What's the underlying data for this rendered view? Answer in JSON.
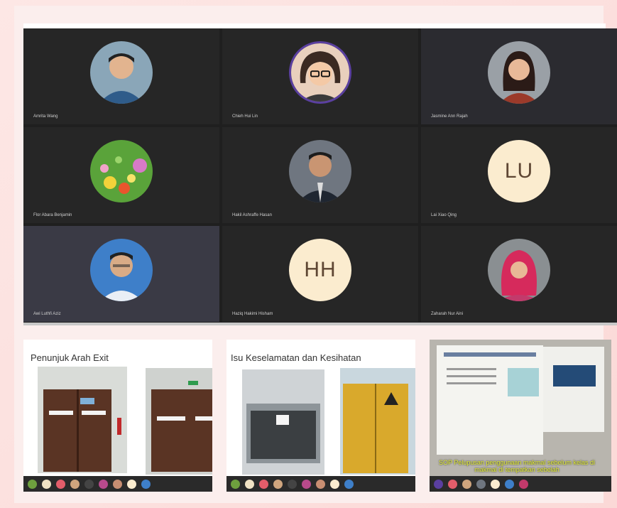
{
  "meeting": {
    "participants": [
      {
        "name": "Amrita Wang",
        "type": "photo",
        "tone": "#8aa6b8"
      },
      {
        "name": "Chieh Hui Lin",
        "type": "avatar",
        "tone": "#5a3fa0"
      },
      {
        "name": "Jasmine Ann Rajah",
        "type": "photo",
        "tone": "#9b6a5a"
      },
      {
        "name": "Flor Abara Benjamin",
        "type": "flowers",
        "tone": "#5aa33a"
      },
      {
        "name": "Hakil Ashraffe Hasan",
        "type": "photo",
        "tone": "#6f7680"
      },
      {
        "name": "Lai Xiao Qing",
        "initials": "LU",
        "type": "initials"
      },
      {
        "name": "Awi Luthfi Aziz",
        "type": "photo",
        "tone": "#3e7fc9"
      },
      {
        "name": "Haziq Hakimi Hisham",
        "initials": "HH",
        "type": "initials"
      },
      {
        "name": "Zaharah Nur Aini",
        "type": "photo",
        "tone": "#c23a6b"
      }
    ]
  },
  "slides": [
    {
      "title": "Penunjuk Arah Exit"
    },
    {
      "title": "Isu Keselamatan dan Kesihatan"
    },
    {
      "title": "",
      "caption": "SOP Pelupusan penggunaan makmal sebelum kelas di makmal di tempatkan sebelah"
    }
  ],
  "colors": {
    "background": "#fde3e1",
    "meeting_bg": "#1f1f1f",
    "initials_bg": "#fbeccf",
    "caption": "#e5ef34"
  }
}
